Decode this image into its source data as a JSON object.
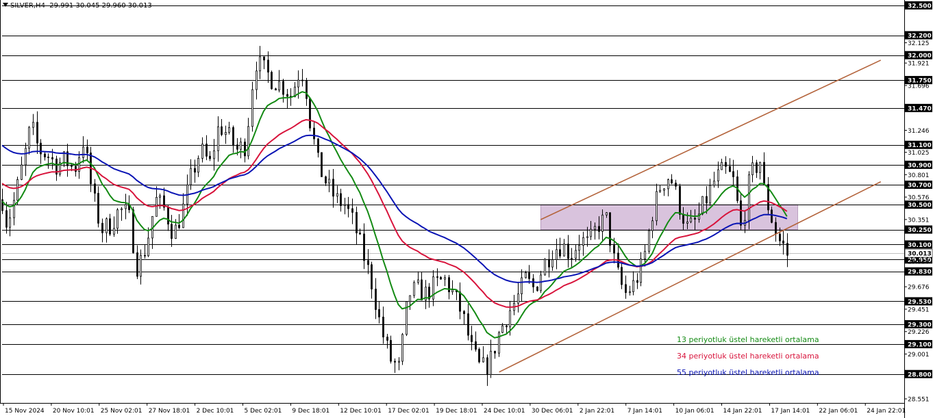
{
  "header": {
    "symbol": "SILVER,H4",
    "ohlc": "29.991 30.045 29.960 30.013"
  },
  "colors": {
    "candle": "#000000",
    "hline": "#000000",
    "channel": "#b4643c",
    "zone_fill": "#d9c3dd",
    "ema13": "#138a13",
    "ema34": "#d8143c",
    "ema55": "#0a14b4",
    "price_label_bg": "#000000",
    "price_label_text": "#ffffff",
    "bid_line": "#c0c0c0"
  },
  "legend": [
    {
      "label": "13 periyotluk üstel hareketli ortalama",
      "color": "#138a13"
    },
    {
      "label": "34 periyotluk üstel hareketli ortalama",
      "color": "#d8143c"
    },
    {
      "label": "55 periyotluk üstel hareketli ortalama",
      "color": "#0a14b4"
    }
  ],
  "chart_data": {
    "type": "candlestick",
    "ylim": [
      28.51,
      32.54
    ],
    "y_tick_labels": [
      "32.125",
      "31.921",
      "31.696",
      "31.246",
      "31.025",
      "30.801",
      "30.576",
      "30.351",
      "29.676",
      "29.451",
      "29.226",
      "29.001",
      "28.551"
    ],
    "x_tick_labels": [
      "15 Nov 2024",
      "20 Nov 10:01",
      "25 Nov 02:01",
      "27 Nov 18:01",
      "2 Dec 10:01",
      "5 Dec 02:01",
      "9 Dec 18:01",
      "12 Dec 10:01",
      "17 Dec 02:01",
      "19 Dec 18:01",
      "24 Dec 10:01",
      "30 Dec 06:01",
      "2 Jan 22:01",
      "7 Jan 14:01",
      "10 Jan 06:01",
      "14 Jan 22:01",
      "17 Jan 14:01",
      "22 Jan 06:01",
      "24 Jan 22:01"
    ],
    "horizontal_levels": [
      "32.500",
      "32.200",
      "32.000",
      "31.750",
      "31.470",
      "31.100",
      "30.900",
      "30.700",
      "30.500",
      "30.250",
      "30.100",
      "29.950",
      "29.830",
      "29.530",
      "29.300",
      "29.100",
      "28.800"
    ],
    "current_price": "30.013",
    "extra_price_label": "29.930",
    "resistance_zone": {
      "from_x": 0.597,
      "to_x": 0.882,
      "low": 30.25,
      "high": 30.5
    },
    "channel_lines": [
      {
        "name": "upper",
        "from": {
          "x": 0.597,
          "price": 30.35
        },
        "to": {
          "x": 0.974,
          "price": 31.95
        }
      },
      {
        "name": "lower",
        "from": {
          "x": 0.551,
          "price": 28.82
        },
        "to": {
          "x": 0.974,
          "price": 30.73
        }
      }
    ],
    "price_path": [
      [
        0.0,
        30.55
      ],
      [
        0.005,
        30.3
      ],
      [
        0.015,
        30.6
      ],
      [
        0.025,
        31.0
      ],
      [
        0.032,
        31.3
      ],
      [
        0.04,
        31.05
      ],
      [
        0.05,
        31.0
      ],
      [
        0.06,
        30.9
      ],
      [
        0.07,
        30.95
      ],
      [
        0.08,
        30.85
      ],
      [
        0.09,
        31.15
      ],
      [
        0.1,
        30.6
      ],
      [
        0.11,
        30.25
      ],
      [
        0.12,
        30.3
      ],
      [
        0.13,
        30.45
      ],
      [
        0.14,
        30.4
      ],
      [
        0.15,
        29.85
      ],
      [
        0.16,
        30.1
      ],
      [
        0.17,
        30.55
      ],
      [
        0.18,
        30.45
      ],
      [
        0.19,
        30.2
      ],
      [
        0.2,
        30.45
      ],
      [
        0.21,
        30.8
      ],
      [
        0.22,
        31.05
      ],
      [
        0.23,
        30.9
      ],
      [
        0.24,
        31.3
      ],
      [
        0.25,
        31.2
      ],
      [
        0.26,
        31.05
      ],
      [
        0.27,
        31.1
      ],
      [
        0.28,
        31.95
      ],
      [
        0.29,
        31.85
      ],
      [
        0.3,
        31.75
      ],
      [
        0.31,
        31.7
      ],
      [
        0.32,
        31.6
      ],
      [
        0.33,
        31.85
      ],
      [
        0.335,
        31.8
      ],
      [
        0.34,
        31.4
      ],
      [
        0.35,
        30.9
      ],
      [
        0.36,
        30.7
      ],
      [
        0.37,
        30.55
      ],
      [
        0.38,
        30.5
      ],
      [
        0.39,
        30.3
      ],
      [
        0.4,
        30.0
      ],
      [
        0.41,
        29.7
      ],
      [
        0.42,
        29.25
      ],
      [
        0.43,
        28.95
      ],
      [
        0.44,
        28.85
      ],
      [
        0.45,
        29.6
      ],
      [
        0.46,
        29.65
      ],
      [
        0.47,
        29.6
      ],
      [
        0.48,
        29.7
      ],
      [
        0.49,
        29.75
      ],
      [
        0.5,
        29.6
      ],
      [
        0.51,
        29.4
      ],
      [
        0.52,
        29.05
      ],
      [
        0.53,
        28.85
      ],
      [
        0.54,
        28.9
      ],
      [
        0.55,
        29.2
      ],
      [
        0.56,
        29.4
      ],
      [
        0.57,
        29.55
      ],
      [
        0.58,
        29.75
      ],
      [
        0.59,
        29.65
      ],
      [
        0.6,
        29.9
      ],
      [
        0.61,
        30.05
      ],
      [
        0.62,
        30.1
      ],
      [
        0.63,
        30.0
      ],
      [
        0.64,
        30.15
      ],
      [
        0.65,
        30.1
      ],
      [
        0.66,
        30.3
      ],
      [
        0.67,
        30.35
      ],
      [
        0.68,
        29.85
      ],
      [
        0.69,
        29.6
      ],
      [
        0.7,
        29.7
      ],
      [
        0.71,
        29.9
      ],
      [
        0.72,
        30.4
      ],
      [
        0.73,
        30.7
      ],
      [
        0.74,
        30.8
      ],
      [
        0.75,
        30.5
      ],
      [
        0.76,
        30.25
      ],
      [
        0.77,
        30.35
      ],
      [
        0.78,
        30.55
      ],
      [
        0.79,
        30.75
      ],
      [
        0.8,
        30.85
      ],
      [
        0.81,
        30.75
      ],
      [
        0.82,
        30.2
      ],
      [
        0.825,
        30.6
      ],
      [
        0.83,
        30.8
      ],
      [
        0.84,
        30.95
      ],
      [
        0.845,
        30.6
      ],
      [
        0.85,
        30.45
      ],
      [
        0.855,
        30.3
      ],
      [
        0.86,
        30.15
      ],
      [
        0.865,
        30.1
      ],
      [
        0.87,
        30.0
      ]
    ]
  }
}
